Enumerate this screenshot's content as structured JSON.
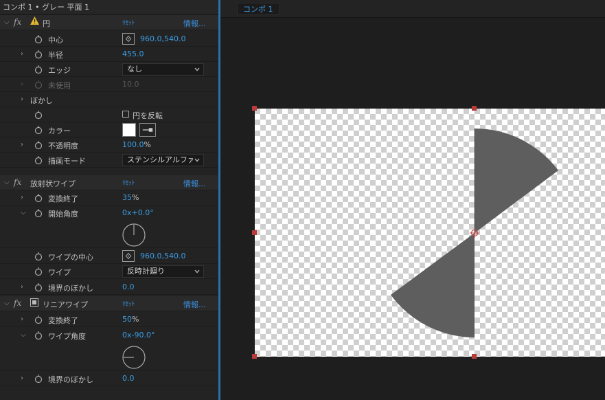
{
  "panel_title": "コンポ 1 • グレー 平面 1",
  "comp_tab": "コンポ 1",
  "effects": {
    "circle": {
      "name": "円",
      "reset": "ﾘｾｯﾄ",
      "info": "情報...",
      "props": {
        "center_label": "中心",
        "center_value": "960.0,540.0",
        "radius_label": "半径",
        "radius_value": "455.0",
        "edge_label": "エッジ",
        "edge_value": "なし",
        "unused_label": "未使用",
        "unused_value": "10.0",
        "feather_label": "ぼかし",
        "invert_label": "円を反転",
        "color_label": "カラー",
        "color_value": "#ffffff",
        "opacity_label": "不透明度",
        "opacity_value": "100.0",
        "opacity_unit": "%",
        "blend_label": "描画モード",
        "blend_value": "ステンシルアルファ"
      }
    },
    "radial_wipe": {
      "name": "放射状ワイプ",
      "reset": "ﾘｾｯﾄ",
      "info": "情報...",
      "props": {
        "completion_label": "変換終了",
        "completion_value": "35",
        "completion_unit": "%",
        "start_angle_label": "開始角度",
        "start_angle_value": "0x+0.0°",
        "center_label": "ワイプの中心",
        "center_value": "960.0,540.0",
        "wipe_label": "ワイプ",
        "wipe_value": "反時計廻り",
        "feather_label": "境界のぼかし",
        "feather_value": "0.0"
      }
    },
    "linear_wipe": {
      "name": "リニアワイプ",
      "reset": "ﾘｾｯﾄ",
      "info": "情報...",
      "props": {
        "completion_label": "変換終了",
        "completion_value": "50",
        "completion_unit": "%",
        "angle_label": "ワイプ角度",
        "angle_value": "0x-90.0°",
        "feather_label": "境界のぼかし",
        "feather_value": "0.0"
      }
    }
  },
  "colors": {
    "accent": "#3b9ee6",
    "shape_fill": "#5e5e5e",
    "handle": "#b83a3a"
  },
  "icons": [
    "twirl-icon",
    "fx-icon",
    "warning-icon",
    "stopwatch-icon",
    "target-icon",
    "eyedropper-icon",
    "chevron-down-icon",
    "angle-dial-icon",
    "mask-icon"
  ]
}
